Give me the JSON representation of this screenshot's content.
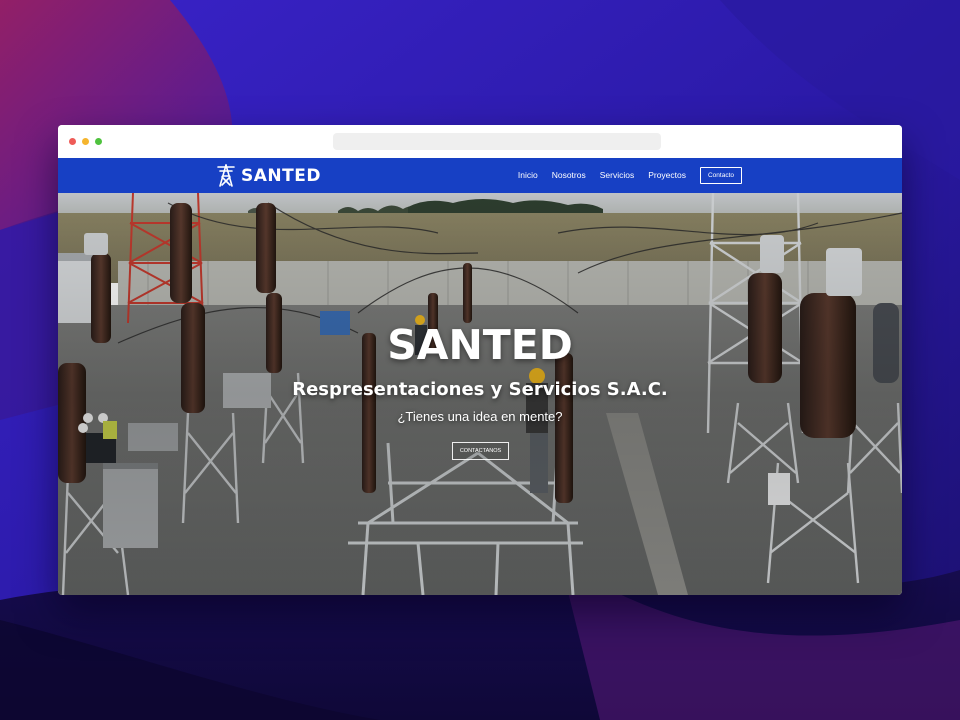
{
  "site": {
    "brand_name": "SANTED",
    "logo_icon": "power-tower-icon"
  },
  "nav": {
    "links": [
      {
        "label": "Inicio"
      },
      {
        "label": "Nosotros"
      },
      {
        "label": "Servicios"
      },
      {
        "label": "Proyectos"
      }
    ],
    "contact_label": "Contacto"
  },
  "hero": {
    "title": "SANTED",
    "subtitle": "Respresentaciones y Servicios S.A.C.",
    "tagline": "¿Tienes una idea en mente?",
    "cta_label": "CONTACTANOS",
    "image": "electrical-substation-photo"
  },
  "colors": {
    "navbar": "#1740c4",
    "backdrop_primary": "#2a1f8f",
    "backdrop_accent": "#8a1f6f"
  }
}
